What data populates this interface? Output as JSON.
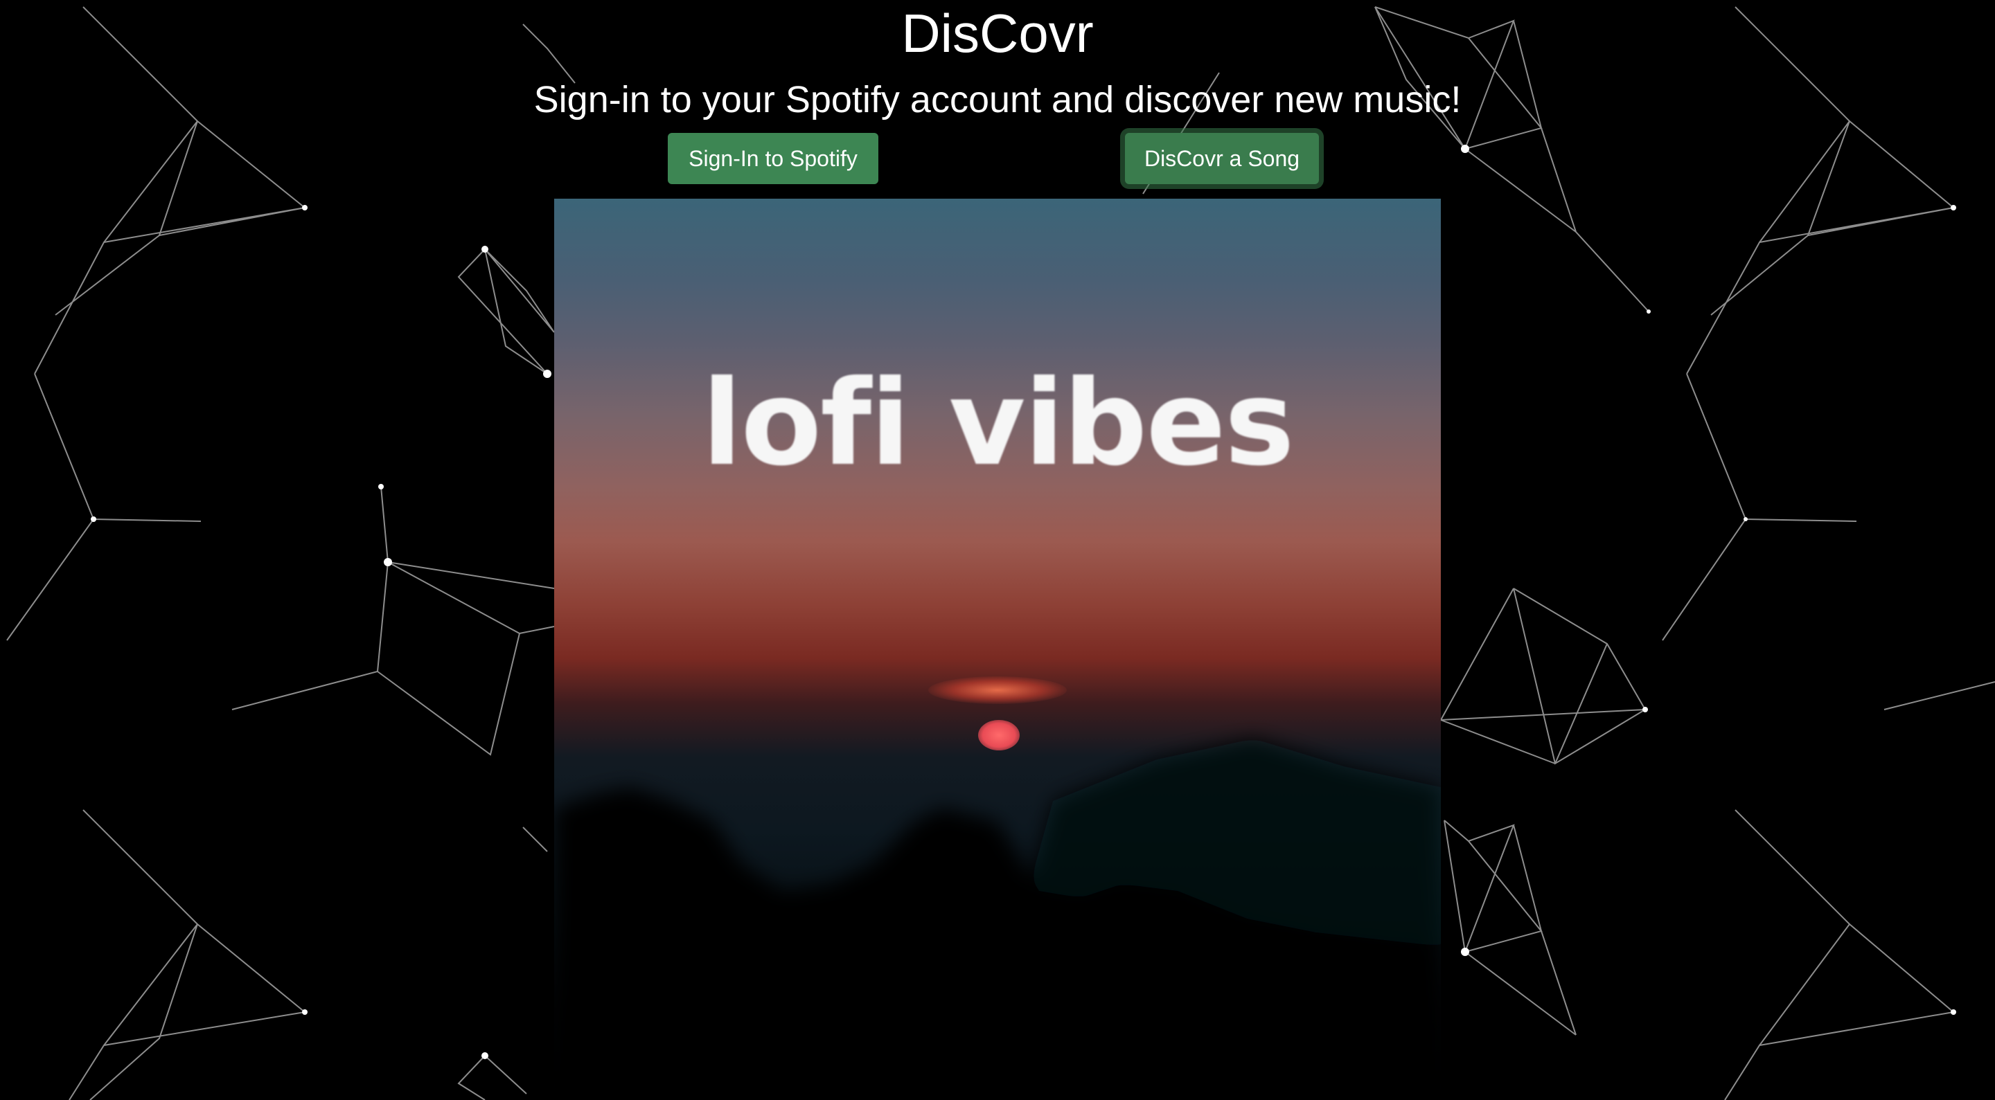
{
  "header": {
    "title": "DisCovr",
    "tagline": "Sign-in to your Spotify account and discover new music!"
  },
  "actions": {
    "signin_label": "Sign-In to Spotify",
    "discover_label": "DisCovr a Song"
  },
  "album": {
    "cover_text": "lofi vibes"
  },
  "colors": {
    "background": "#000000",
    "button": "#3d8653",
    "text": "#ffffff"
  }
}
